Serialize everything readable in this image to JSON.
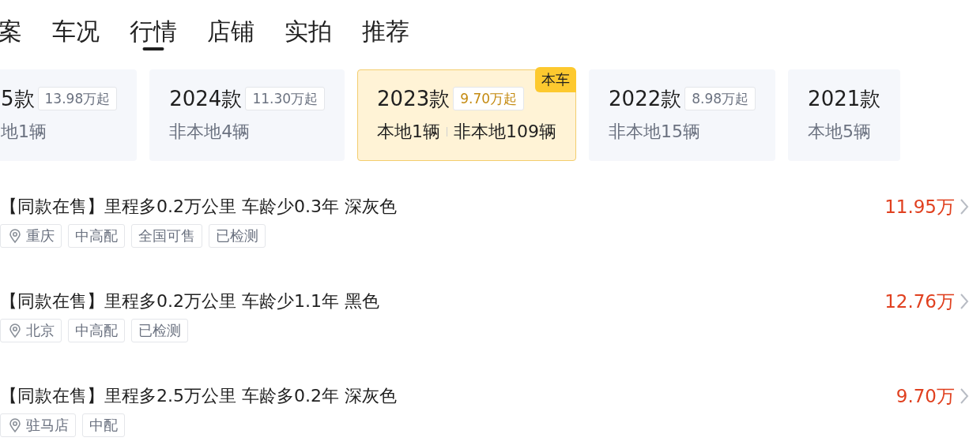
{
  "tabs": [
    {
      "label": "案",
      "selected": false
    },
    {
      "label": "车况",
      "selected": false
    },
    {
      "label": "行情",
      "selected": true
    },
    {
      "label": "店铺",
      "selected": false
    },
    {
      "label": "实拍",
      "selected": false
    },
    {
      "label": "推荐",
      "selected": false
    }
  ],
  "models": [
    {
      "year": "5款",
      "price": "13.98万起",
      "stats": [
        "地1辆"
      ],
      "selected": false
    },
    {
      "year": "2024款",
      "price": "11.30万起",
      "stats": [
        "非本地4辆"
      ],
      "selected": false
    },
    {
      "year": "2023款",
      "price": "9.70万起",
      "stats": [
        "本地1辆",
        "非本地109辆"
      ],
      "selected": true,
      "tag": "本车"
    },
    {
      "year": "2022款",
      "price": "8.98万起",
      "stats": [
        "非本地15辆"
      ],
      "selected": false
    },
    {
      "year": "2021款",
      "stats": [
        "本地5辆"
      ],
      "selected": false
    }
  ],
  "listings": [
    {
      "title": "【同款在售】里程多0.2万公里 车龄少0.3年 深灰色",
      "price": "11.95万",
      "tags": [
        {
          "kind": "location",
          "text": "重庆"
        },
        {
          "kind": "plain",
          "text": "中高配"
        },
        {
          "kind": "plain",
          "text": "全国可售"
        },
        {
          "kind": "plain",
          "text": "已检测"
        }
      ]
    },
    {
      "title": "【同款在售】里程多0.2万公里 车龄少1.1年 黑色",
      "price": "12.76万",
      "tags": [
        {
          "kind": "location",
          "text": "北京"
        },
        {
          "kind": "plain",
          "text": "中高配"
        },
        {
          "kind": "plain",
          "text": "已检测"
        }
      ]
    },
    {
      "title": "【同款在售】里程多2.5万公里 车龄多0.2年 深灰色",
      "price": "9.70万",
      "tags": [
        {
          "kind": "location",
          "text": "驻马店"
        },
        {
          "kind": "plain",
          "text": "中配"
        }
      ]
    }
  ]
}
